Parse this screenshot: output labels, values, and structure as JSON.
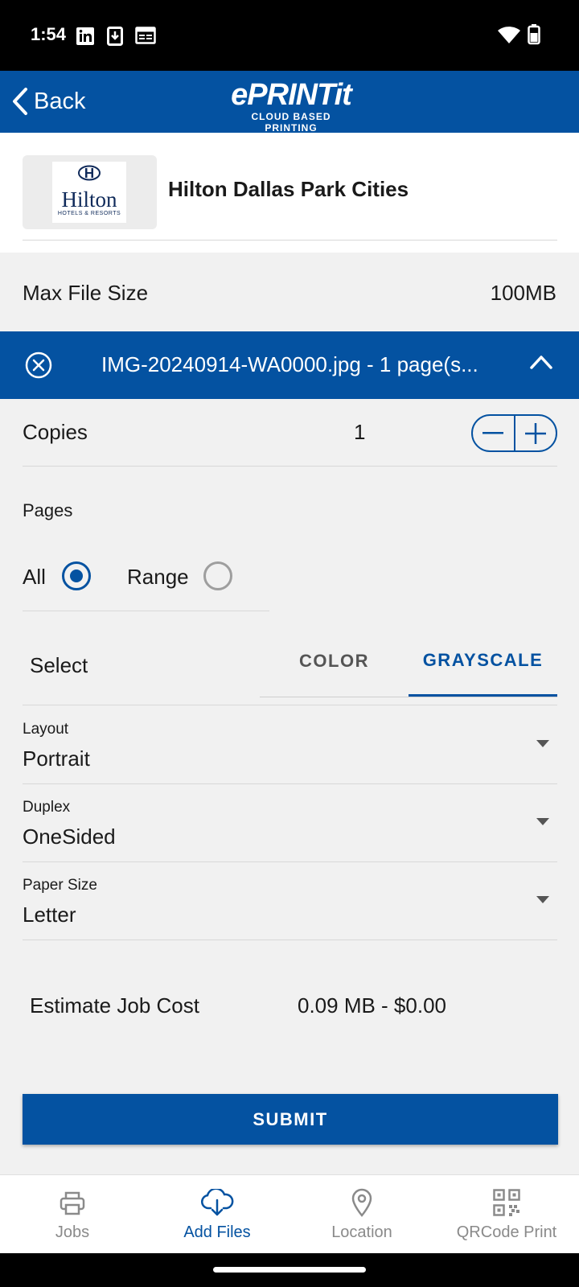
{
  "status_bar": {
    "time": "1:54",
    "icons": [
      "linkedin-icon",
      "download-icon",
      "calendar-icon",
      "wifi-icon",
      "battery-icon"
    ]
  },
  "app_bar": {
    "back_label": "Back",
    "logo_main": "ePRINTit",
    "logo_sub": "CLOUD BASED PRINTING"
  },
  "location": {
    "logo_text": "Hilton",
    "logo_sub": "HOTELS & RESORTS",
    "name": "Hilton Dallas Park Cities"
  },
  "max_file_size": {
    "label": "Max File Size",
    "value": "100MB"
  },
  "file": {
    "name": "IMG-20240914-WA0000.jpg - 1 page(s..."
  },
  "copies": {
    "label": "Copies",
    "value": "1"
  },
  "pages": {
    "label": "Pages",
    "options": [
      "All",
      "Range"
    ],
    "selected": "All"
  },
  "color_select": {
    "label": "Select",
    "tabs": [
      "COLOR",
      "GRAYSCALE"
    ],
    "selected": "GRAYSCALE"
  },
  "dropdowns": {
    "layout": {
      "label": "Layout",
      "value": "Portrait"
    },
    "duplex": {
      "label": "Duplex",
      "value": "OneSided"
    },
    "paper_size": {
      "label": "Paper Size",
      "value": "Letter"
    }
  },
  "estimate": {
    "label": "Estimate Job Cost",
    "value": "0.09 MB - $0.00"
  },
  "submit_label": "SUBMIT",
  "bottom_nav": {
    "items": [
      "Jobs",
      "Add Files",
      "Location",
      "QRCode Print"
    ],
    "active": "Add Files"
  },
  "colors": {
    "primary": "#0452a1",
    "background": "#f1f1f1",
    "inactive": "#8a8a8a"
  }
}
